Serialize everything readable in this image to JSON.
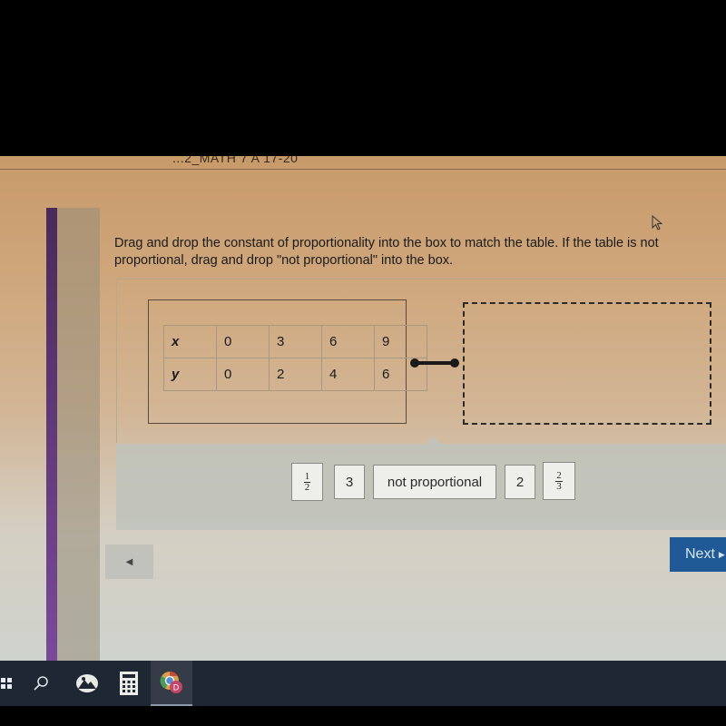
{
  "window": {
    "title": "...2_MATH 7 A 17-20"
  },
  "question": {
    "instructions": "Drag and drop the constant of proportionality into the box to match the table.  If the table is not proportional, drag and drop \"not proportional\" into the box.",
    "table": {
      "rows": [
        {
          "label": "x",
          "values": [
            "0",
            "3",
            "6",
            "9"
          ]
        },
        {
          "label": "y",
          "values": [
            "0",
            "2",
            "4",
            "6"
          ]
        }
      ]
    },
    "drop_box": {
      "content": ""
    }
  },
  "answer_bank": {
    "tiles": [
      {
        "type": "fraction",
        "numerator": "1",
        "denominator": "2"
      },
      {
        "type": "text",
        "label": "3"
      },
      {
        "type": "text",
        "label": "not proportional"
      },
      {
        "type": "text",
        "label": "2"
      },
      {
        "type": "fraction",
        "numerator": "2",
        "denominator": "3"
      }
    ]
  },
  "navigation": {
    "prev_label": "◀",
    "next_label": "Next",
    "next_arrow": "▶",
    "next_color": "#1f5a97"
  },
  "taskbar": {
    "items": [
      {
        "icon": "windows-start-icon"
      },
      {
        "icon": "search-icon"
      },
      {
        "icon": "photos-app-icon"
      },
      {
        "icon": "calculator-icon"
      },
      {
        "icon": "chrome-icon",
        "badge": "D",
        "active": true
      }
    ]
  },
  "colors": {
    "sidebar_accent": "#6a3a8a",
    "taskbar_bg": "#1f2733"
  }
}
